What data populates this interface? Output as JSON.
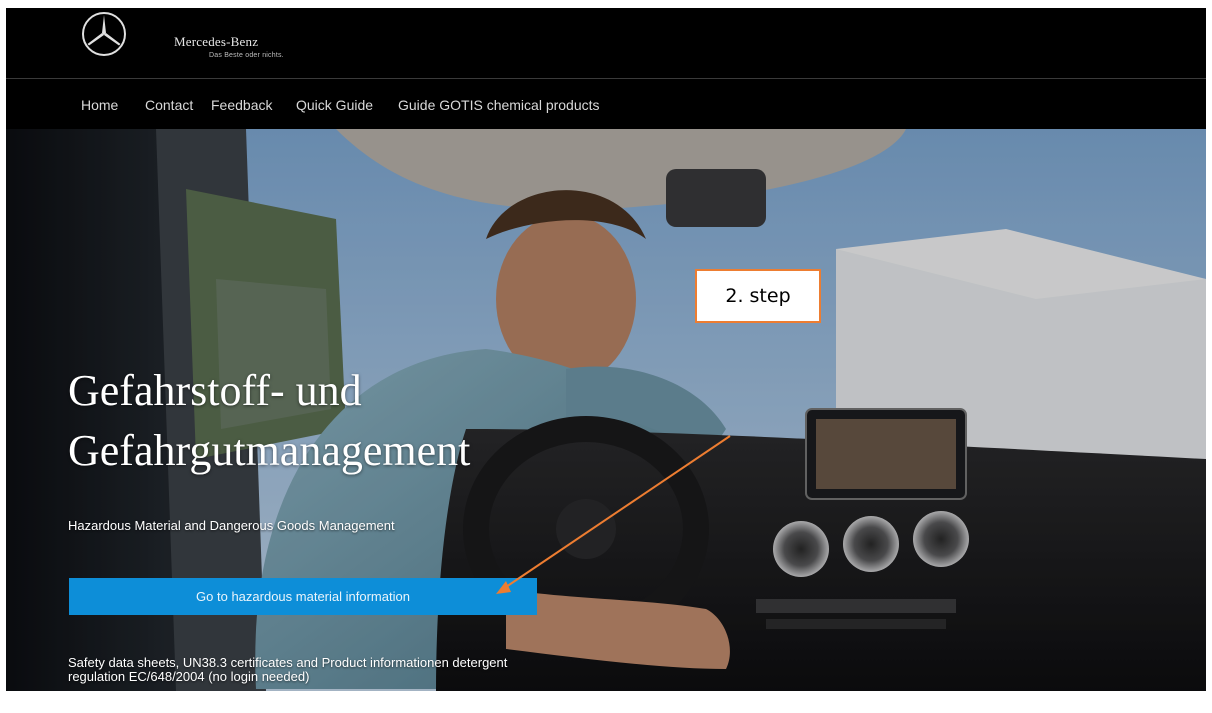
{
  "header": {
    "brand": "Mercedes-Benz",
    "tagline": "Das Beste oder nichts.",
    "logo_icon": "mercedes-star-icon"
  },
  "nav": {
    "items": [
      {
        "label": "Home"
      },
      {
        "label": "Contact"
      },
      {
        "label": "Feedback"
      },
      {
        "label": "Quick Guide"
      },
      {
        "label": "Guide GOTIS chemical products"
      }
    ]
  },
  "hero": {
    "title_line1": "Gefahrstoff- und",
    "title_line2": "Gefahrgutmanagement",
    "subtitle": "Hazardous Material and Dangerous Goods Management",
    "cta_label": "Go to hazardous material information",
    "note_line1": "Safety data sheets, UN38.3 certificates and Product informationen detergent",
    "note_line2": "regulation EC/648/2004 (no login needed)"
  },
  "annotation": {
    "label": "2. step",
    "color": "#ed7d31"
  },
  "colors": {
    "cta_background": "#0d8ed8",
    "header_background": "#000000"
  }
}
